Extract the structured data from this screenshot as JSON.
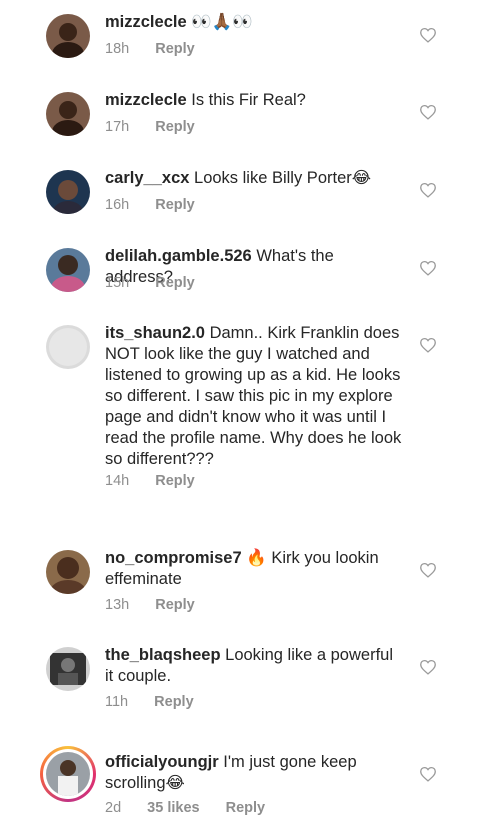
{
  "comments": [
    {
      "username": "mizzclecle",
      "text": "👀🙏🏾👀",
      "time": "18h",
      "reply": "Reply",
      "avatar": "photo-woman-dark"
    },
    {
      "username": "mizzclecle",
      "text": "Is this Fir Real?",
      "time": "17h",
      "reply": "Reply",
      "avatar": "photo-woman-dark"
    },
    {
      "username": "carly__xcx",
      "text": "Looks like Billy Porter😂",
      "time": "16h",
      "reply": "Reply",
      "avatar": "photo-woman-blue"
    },
    {
      "username": "delilah.gamble.526",
      "text": "What's the address?",
      "time": "15h",
      "reply": "Reply",
      "avatar": "photo-man-colorful"
    },
    {
      "username": "its_shaun2.0",
      "text": "Damn.. Kirk Franklin does NOT look like the guy I watched and listened to growing up as a kid. He looks so different. I saw this pic in my explore page and didn't know who it was until I read the profile name. Why does he look so different???",
      "time": "14h",
      "reply": "Reply",
      "avatar": "default-avatar"
    },
    {
      "username": "no_compromise7",
      "text": "🔥 Kirk you lookin effeminate",
      "time": "13h",
      "reply": "Reply",
      "avatar": "photo-man-brown"
    },
    {
      "username": "the_blaqsheep",
      "text": "Looking like a powerful it couple.",
      "time": "11h",
      "reply": "Reply",
      "avatar": "photo-man-black-white"
    },
    {
      "username": "officialyoungjr",
      "text": "I'm just gone keep scrolling😂",
      "time": "2d",
      "likes": "35 likes",
      "reply": "Reply",
      "avatar": "photo-man-story-ring"
    }
  ],
  "colors": {
    "text": "#262626",
    "meta": "#8e8e8e",
    "heart": "#9a9a9a"
  },
  "icons": {
    "like": "heart-outline-icon"
  }
}
